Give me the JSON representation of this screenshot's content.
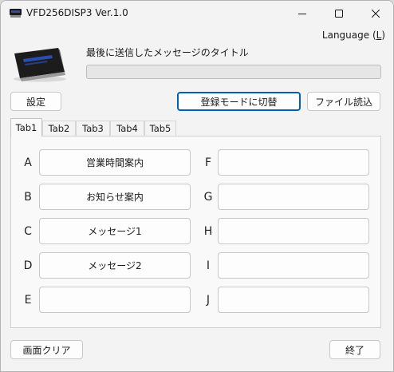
{
  "window": {
    "title": "VFD256DISP3 Ver.1.0",
    "controls": {
      "minimize_icon": "minimize-icon",
      "maximize_icon": "maximize-icon",
      "close_icon": "close-icon"
    }
  },
  "menu": {
    "language_label": "Language (",
    "language_key": "L",
    "language_close": ")"
  },
  "header": {
    "last_message_title_label": "最後に送信したメッセージのタイトル",
    "progress_fraction": 0
  },
  "buttons": {
    "settings": "設定",
    "register_mode": "登録モードに切替",
    "file_load": "ファイル読込",
    "clear_screen": "画面クリア",
    "exit": "終了"
  },
  "tabs": [
    {
      "label": "Tab1",
      "active": true
    },
    {
      "label": "Tab2",
      "active": false
    },
    {
      "label": "Tab3",
      "active": false
    },
    {
      "label": "Tab4",
      "active": false
    },
    {
      "label": "Tab5",
      "active": false
    }
  ],
  "slots_left": [
    {
      "letter": "A",
      "label": "営業時間案内"
    },
    {
      "letter": "B",
      "label": "お知らせ案内"
    },
    {
      "letter": "C",
      "label": "メッセージ1"
    },
    {
      "letter": "D",
      "label": "メッセージ2"
    },
    {
      "letter": "E",
      "label": ""
    }
  ],
  "slots_right": [
    {
      "letter": "F",
      "label": ""
    },
    {
      "letter": "G",
      "label": ""
    },
    {
      "letter": "H",
      "label": ""
    },
    {
      "letter": "I",
      "label": ""
    },
    {
      "letter": "J",
      "label": ""
    }
  ],
  "colors": {
    "accent": "#005fb8",
    "window_bg": "#f3f3f3",
    "panel_bg": "#f9f9f9"
  }
}
